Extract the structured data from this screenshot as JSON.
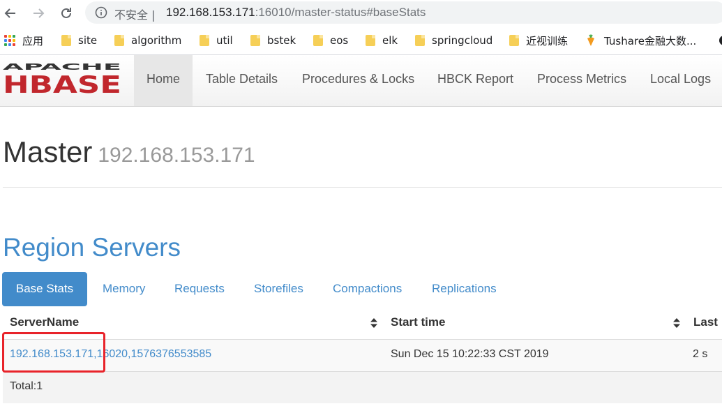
{
  "browser": {
    "security_label": "不安全 |",
    "url_host": "192.168.153.171",
    "url_rest": ":16010/master-status#baseStats"
  },
  "bookmarks": [
    {
      "label": "应用",
      "icon": "apps-grid-icon"
    },
    {
      "label": "site",
      "icon": "folder-icon"
    },
    {
      "label": "algorithm",
      "icon": "folder-icon"
    },
    {
      "label": "util",
      "icon": "folder-icon"
    },
    {
      "label": "bstek",
      "icon": "folder-icon"
    },
    {
      "label": "eos",
      "icon": "folder-icon"
    },
    {
      "label": "elk",
      "icon": "folder-icon"
    },
    {
      "label": "springcloud",
      "icon": "folder-icon"
    },
    {
      "label": "近视训练",
      "icon": "folder-icon"
    },
    {
      "label": "Tushare金融大数...",
      "icon": "carrot-icon"
    }
  ],
  "hbase": {
    "logo_top": "APACHE",
    "logo_bottom": "HBASE",
    "nav": [
      "Home",
      "Table Details",
      "Procedures & Locks",
      "HBCK Report",
      "Process Metrics",
      "Local Logs"
    ]
  },
  "page": {
    "title": "Master",
    "host": "192.168.153.171",
    "section": "Region Servers",
    "tabs": [
      "Base Stats",
      "Memory",
      "Requests",
      "Storefiles",
      "Compactions",
      "Replications"
    ],
    "table": {
      "headers": [
        "ServerName",
        "Start time",
        "Last"
      ],
      "rows": [
        {
          "server": "192.168.153.171,16020,1576376553585",
          "start": "Sun Dec 15 10:22:33 CST 2019",
          "last": "2 s"
        }
      ],
      "total": "Total:1"
    }
  },
  "colors": {
    "link": "#428bca",
    "highlight": "#e8232a",
    "logo_red": "#c1272d"
  }
}
